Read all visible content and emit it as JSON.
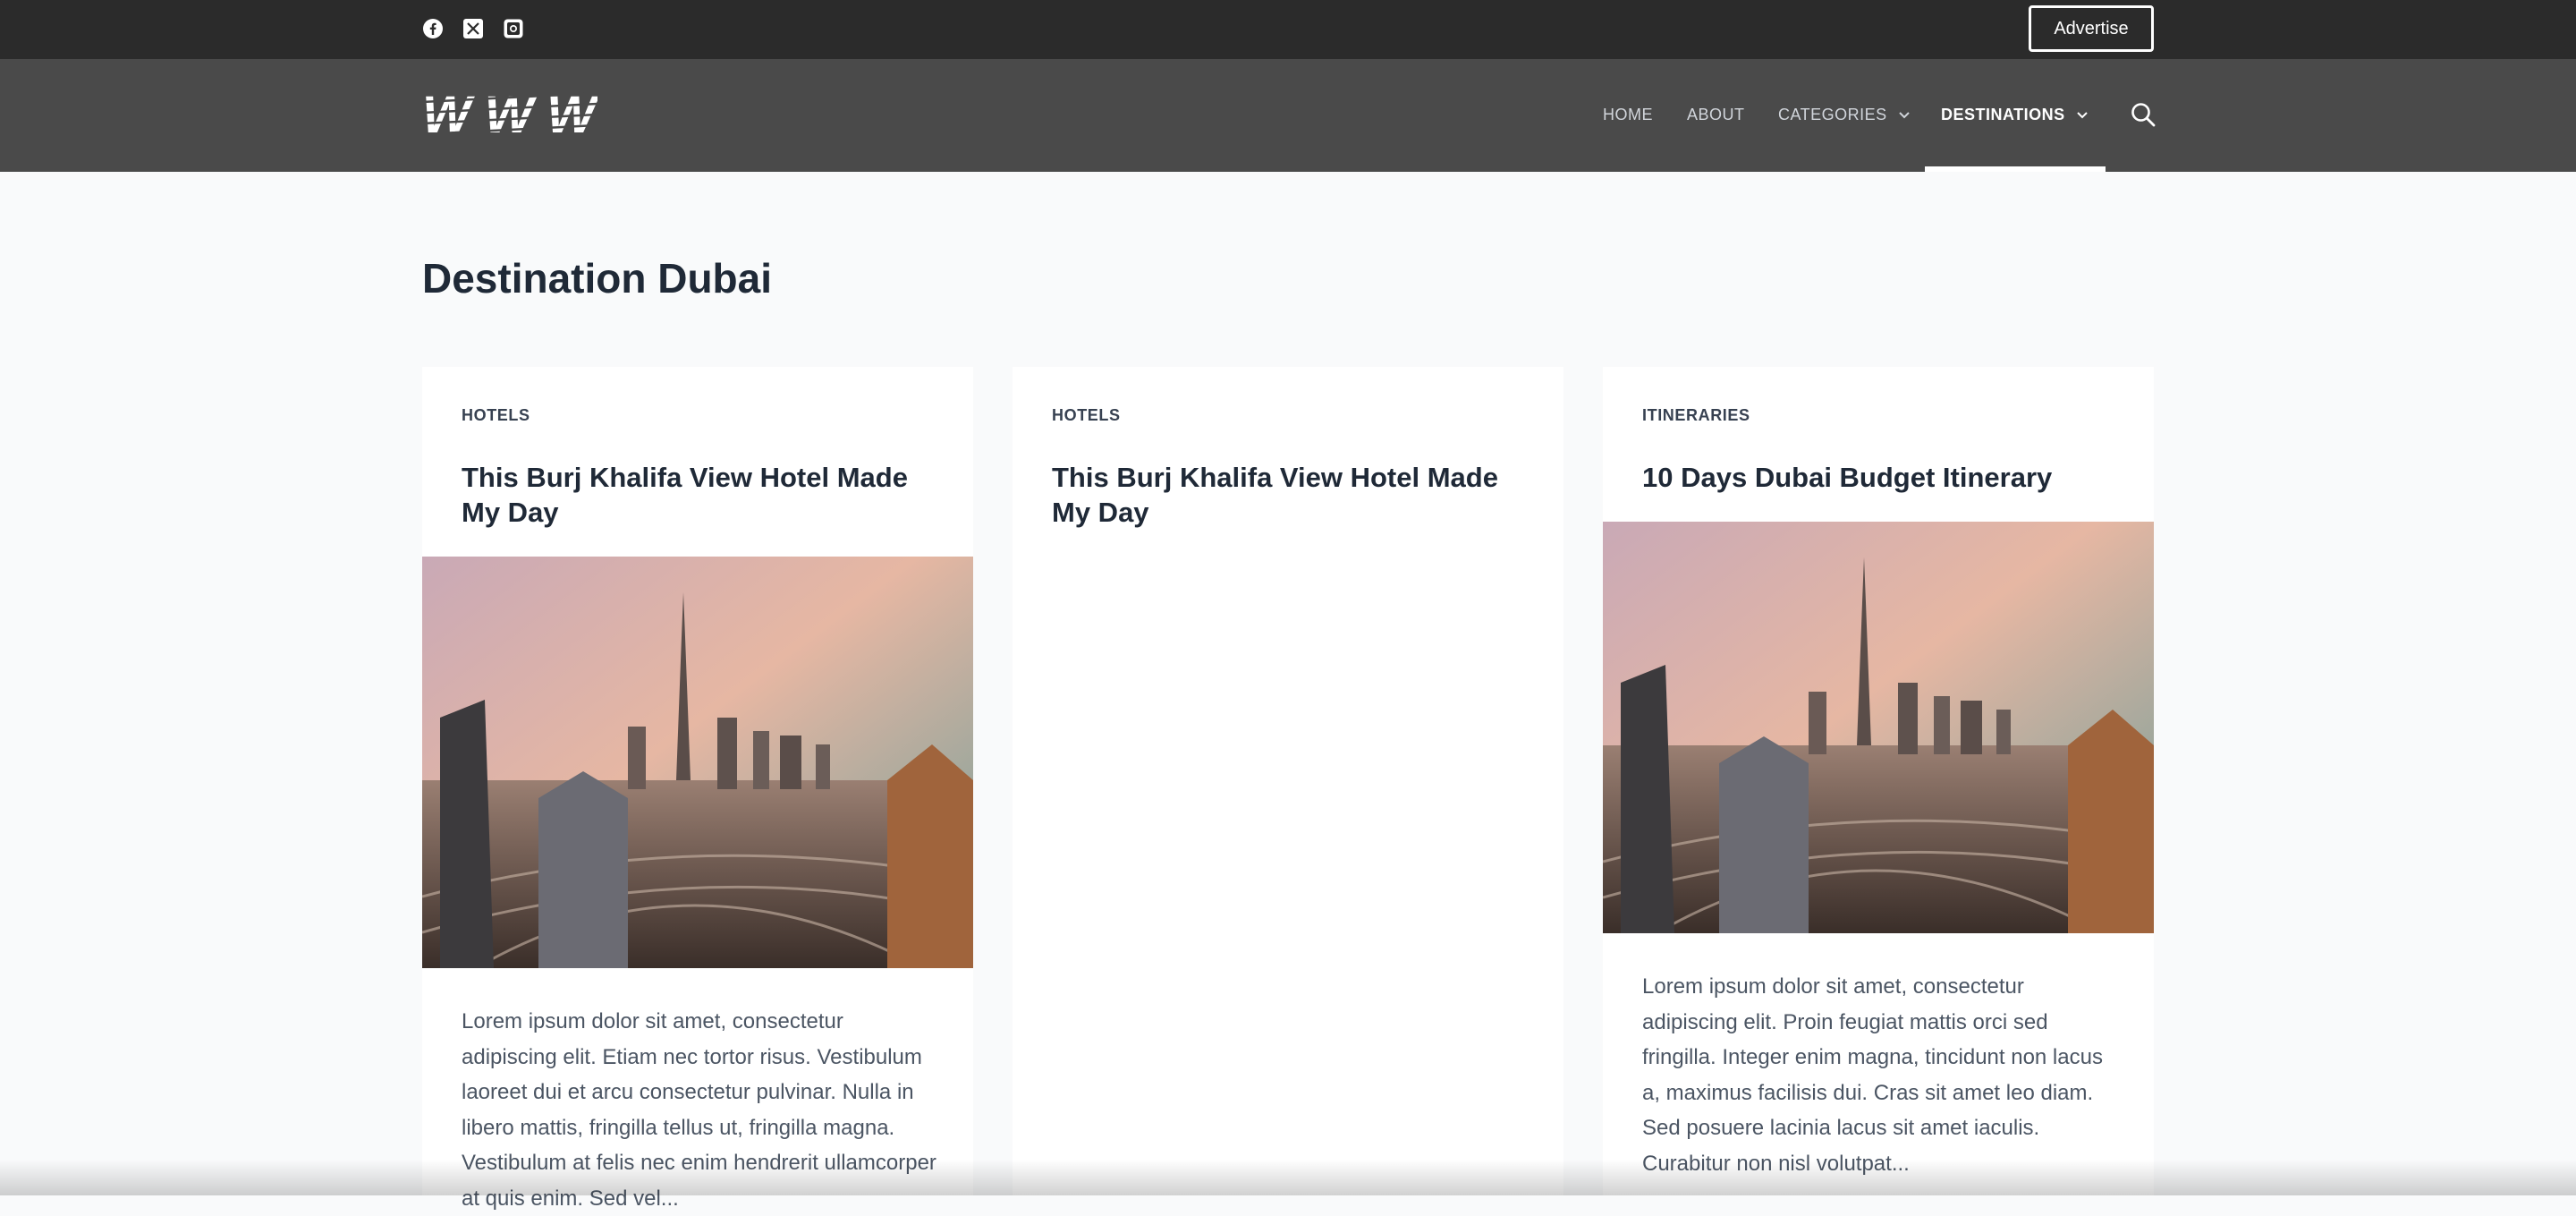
{
  "topbar": {
    "social_icons": [
      "facebook-icon",
      "x-icon",
      "instagram-icon"
    ],
    "advertise_label": "Advertise"
  },
  "header": {
    "logo_text": "WWW",
    "nav": [
      {
        "label": "HOME",
        "has_dropdown": false,
        "active": false
      },
      {
        "label": "ABOUT",
        "has_dropdown": false,
        "active": false
      },
      {
        "label": "CATEGORIES",
        "has_dropdown": true,
        "active": false
      },
      {
        "label": "DESTINATIONS",
        "has_dropdown": true,
        "active": true
      }
    ],
    "search_icon": "search-icon"
  },
  "page": {
    "title": "Destination Dubai"
  },
  "cards": [
    {
      "category": "HOTELS",
      "title": "This Burj Khalifa View Hotel Made My Day",
      "has_image": true,
      "excerpt": "Lorem ipsum dolor sit amet, consectetur adipiscing elit. Etiam nec tortor risus. Vestibulum laoreet dui et arcu consectetur pulvinar. Nulla in libero mattis, fringilla tellus ut, fringilla magna. Vestibulum at felis nec enim hendrerit ullamcorper at quis enim. Sed vel..."
    },
    {
      "category": "HOTELS",
      "title": "This Burj Khalifa View Hotel Made My Day",
      "has_image": false,
      "excerpt": ""
    },
    {
      "category": "ITINERARIES",
      "title": "10 Days Dubai Budget Itinerary",
      "has_image": true,
      "excerpt": "Lorem ipsum dolor sit amet, consectetur adipiscing elit. Proin feugiat mattis orci sed fringilla. Integer enim magna, tincidunt non lacus a, maximus facilisis dui. Cras sit amet leo diam. Sed posuere lacinia lacus sit amet iaculis. Curabitur non nisl volutpat..."
    }
  ],
  "colors": {
    "topbar_bg": "#2b2b2b",
    "header_bg": "#4a4a4a",
    "page_bg": "#f9fafb",
    "card_bg": "#ffffff",
    "text_dark": "#1f2937"
  }
}
